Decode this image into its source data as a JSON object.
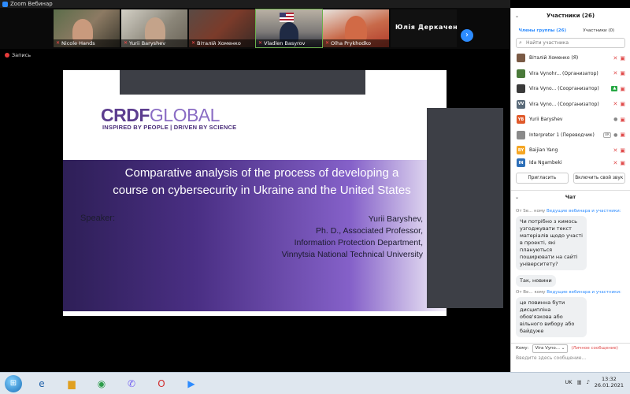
{
  "window": {
    "title": "Zoom Вебинар"
  },
  "videos": [
    {
      "name": "Nicole Hands"
    },
    {
      "name": "Yurii Baryshev"
    },
    {
      "name": "Віталій Хоменко"
    },
    {
      "name": "Vladlen Basyrov"
    },
    {
      "name": "Olha Prykhodko"
    },
    {
      "name": "Юлія Деркачен..."
    }
  ],
  "recording": {
    "label": "Запись"
  },
  "slide": {
    "logo_main_a": "CRDF",
    "logo_main_b": "GLOBAL",
    "logo_sub": "INSPIRED BY PEOPLE | DRIVEN BY SCIENCE",
    "title_line1": "Comparative analysis of the process of developing a",
    "title_line2": "course on cybersecurity in Ukraine and the United States",
    "speaker_label": "Speaker:",
    "speaker_name": "Yurii Baryshev,",
    "speaker_degree": "Ph. D., Associated Professor,",
    "speaker_dept": "Information Protection Department,",
    "speaker_uni": "Vinnytsia National Technical University"
  },
  "participants": {
    "header": "Участники (26)",
    "tab_group": "Члены группы (26)",
    "tab_attendees": "Участники (0)",
    "search_placeholder": "Найти участника",
    "list": [
      {
        "name": "Віталій Хоменко (Я)",
        "avatar_color": "#7a5a45",
        "initials": ""
      },
      {
        "name": "Vira Vynohr... (Организатор)",
        "avatar_color": "#4a7a3a",
        "initials": ""
      },
      {
        "name": "Vira Vyno... (Соорганизатор)",
        "avatar_color": "#3a3a3a",
        "initials": ""
      },
      {
        "name": "Vira Vyno... (Соорганизатор)",
        "avatar_color": "#5a6b7a",
        "initials": "VV"
      },
      {
        "name": "Yurii Baryshev",
        "avatar_color": "#e0592a",
        "initials": "YB"
      },
      {
        "name": "Interpreter 1 (Переводчик)",
        "avatar_color": "#8a8a8a",
        "initials": ""
      },
      {
        "name": "Baijian Yang",
        "avatar_color": "#f5a623",
        "initials": "BY"
      },
      {
        "name": "Ida Ngambeki",
        "avatar_color": "#2d6fb8",
        "initials": "IN"
      }
    ],
    "btn_invite": "Пригласить",
    "btn_unmute_all": "Включить свой звук"
  },
  "chat": {
    "header": "Чат",
    "messages": [
      {
        "from": "От Se...",
        "to_prefix": "кому",
        "to": "Ведущие вебинара и участники:",
        "text": "Чи потрібно з кимось узгоджувати текст матеріалів щодо участі в проекті, які плануються поширювати на сайті університету?"
      },
      {
        "from": "",
        "to_prefix": "",
        "to": "",
        "text": "Так, новини"
      },
      {
        "from": "От Ве...",
        "to_prefix": "кому",
        "to": "Ведущие вебинара и участники:",
        "text": "це повинна бути дисципліна обов'язкова або вільного вибору або байдуже"
      }
    ],
    "to_label": "Кому:",
    "to_value": "Vira Vyno...",
    "private_label": "(Личное сообщение)",
    "input_placeholder": "Введите здесь сообщение..."
  },
  "taskbar": {
    "lang": "UK",
    "time": "13:32",
    "date": "26.01.2021"
  }
}
